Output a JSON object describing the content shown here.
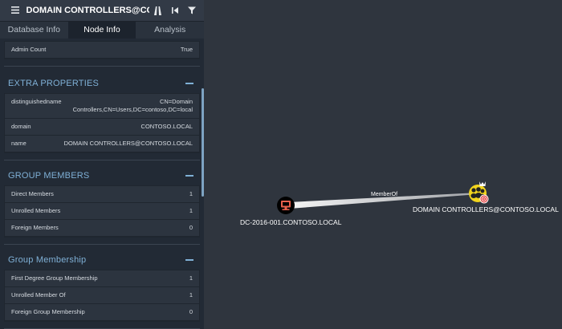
{
  "search": {
    "value": "DOMAIN CONTROLLERS@CONTOSO.LOCAL"
  },
  "tabs": [
    {
      "label": "Database Info",
      "active": false
    },
    {
      "label": "Node Info",
      "active": true
    },
    {
      "label": "Analysis",
      "active": false
    }
  ],
  "top_row": {
    "label": "Admin Count",
    "value": "True"
  },
  "extra_properties": {
    "title": "EXTRA PROPERTIES",
    "rows": [
      {
        "label": "distinguishedname",
        "value": "CN=Domain Controllers,CN=Users,DC=contoso,DC=local"
      },
      {
        "label": "domain",
        "value": "CONTOSO.LOCAL"
      },
      {
        "label": "name",
        "value": "DOMAIN CONTROLLERS@CONTOSO.LOCAL"
      }
    ]
  },
  "group_members": {
    "title": "GROUP MEMBERS",
    "rows": [
      {
        "label": "Direct Members",
        "value": "1"
      },
      {
        "label": "Unrolled Members",
        "value": "1"
      },
      {
        "label": "Foreign Members",
        "value": "0"
      }
    ]
  },
  "group_membership": {
    "title": "Group Membership",
    "rows": [
      {
        "label": "First Degree Group Membership",
        "value": "1"
      },
      {
        "label": "Unrolled Member Of",
        "value": "1"
      },
      {
        "label": "Foreign Group Membership",
        "value": "0"
      }
    ]
  },
  "graph": {
    "computer_node": {
      "label": "DC-2016-001.CONTOSO.LOCAL",
      "icon": "computer-icon",
      "color": "#e8604c"
    },
    "group_node": {
      "label": "DOMAIN CONTROLLERS@CONTOSO.LOCAL",
      "icon": "group-icon",
      "color": "#f1d41d"
    },
    "edge": {
      "label": "MemberOf"
    }
  },
  "colors": {
    "panel": "#222a35",
    "canvas": "#2f353e",
    "accent": "#7fb0d6"
  }
}
